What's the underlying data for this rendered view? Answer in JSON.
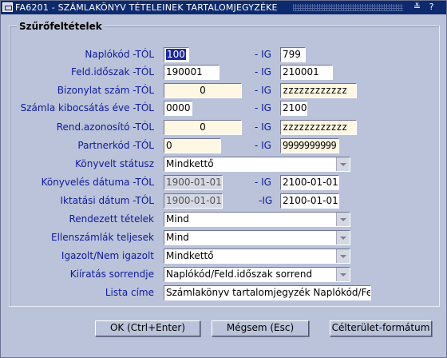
{
  "window": {
    "title": "FA6201 - SZÁMLAKÖNYV TÉTELEINEK TARTALOMJEGYZÉKE",
    "controls": [
      "≚",
      "?"
    ]
  },
  "group_title": "Szűrőfeltételek",
  "ig_label": "- IG",
  "ig_label_alt": "-IG",
  "rows": {
    "naplokod": {
      "label": "Naplókód -TÓL",
      "from": "100",
      "to": "799"
    },
    "feld_idoszak": {
      "label": "Feld.időszak -TÓL",
      "from": "190001",
      "to": "210001"
    },
    "bizonylat": {
      "label": "Bizonylat szám -TÓL",
      "from": "0",
      "to": "zzzzzzzzzzzz"
    },
    "kibocsatas": {
      "label": "Számla kibocsátás éve -TÓL",
      "from": "0000",
      "to": "2100"
    },
    "rend_azon": {
      "label": "Rend.azonosító -TÓL",
      "from": "0",
      "to": "zzzzzzzzzzzz"
    },
    "partnerkod": {
      "label": "Partnerkód -TÓL",
      "from": "0",
      "to": "9999999999"
    },
    "konyvelt_statusz": {
      "label": "Könyvelt státusz",
      "value": "Mindkettő"
    },
    "konyveles_datuma": {
      "label": "Könyvelés dátuma -TÓL",
      "from": "1900-01-01",
      "to": "2100-01-01"
    },
    "iktatasi_datum": {
      "label": "Iktatási dátum -TÓL",
      "from": "1900-01-01",
      "to": "2100-01-01"
    },
    "rendezett": {
      "label": "Rendezett tételek",
      "value": "Mind"
    },
    "ellenszamlak": {
      "label": "Ellenszámlák teljesek",
      "value": "Mind"
    },
    "igazolt": {
      "label": "Igazolt/Nem igazolt",
      "value": "Mindkettő"
    },
    "kiiratas": {
      "label": "Kiíratás sorrendje",
      "value": "Naplókód/Feld.időszak sorrend"
    },
    "lista_cime": {
      "label": "Lista címe",
      "value": "Számlakönyv tartalomjegyzék Naplókód/Feld"
    }
  },
  "buttons": {
    "ok": "OK (Ctrl+Enter)",
    "cancel": "Mégsem (Esc)",
    "target": "Célterület-formátum"
  }
}
